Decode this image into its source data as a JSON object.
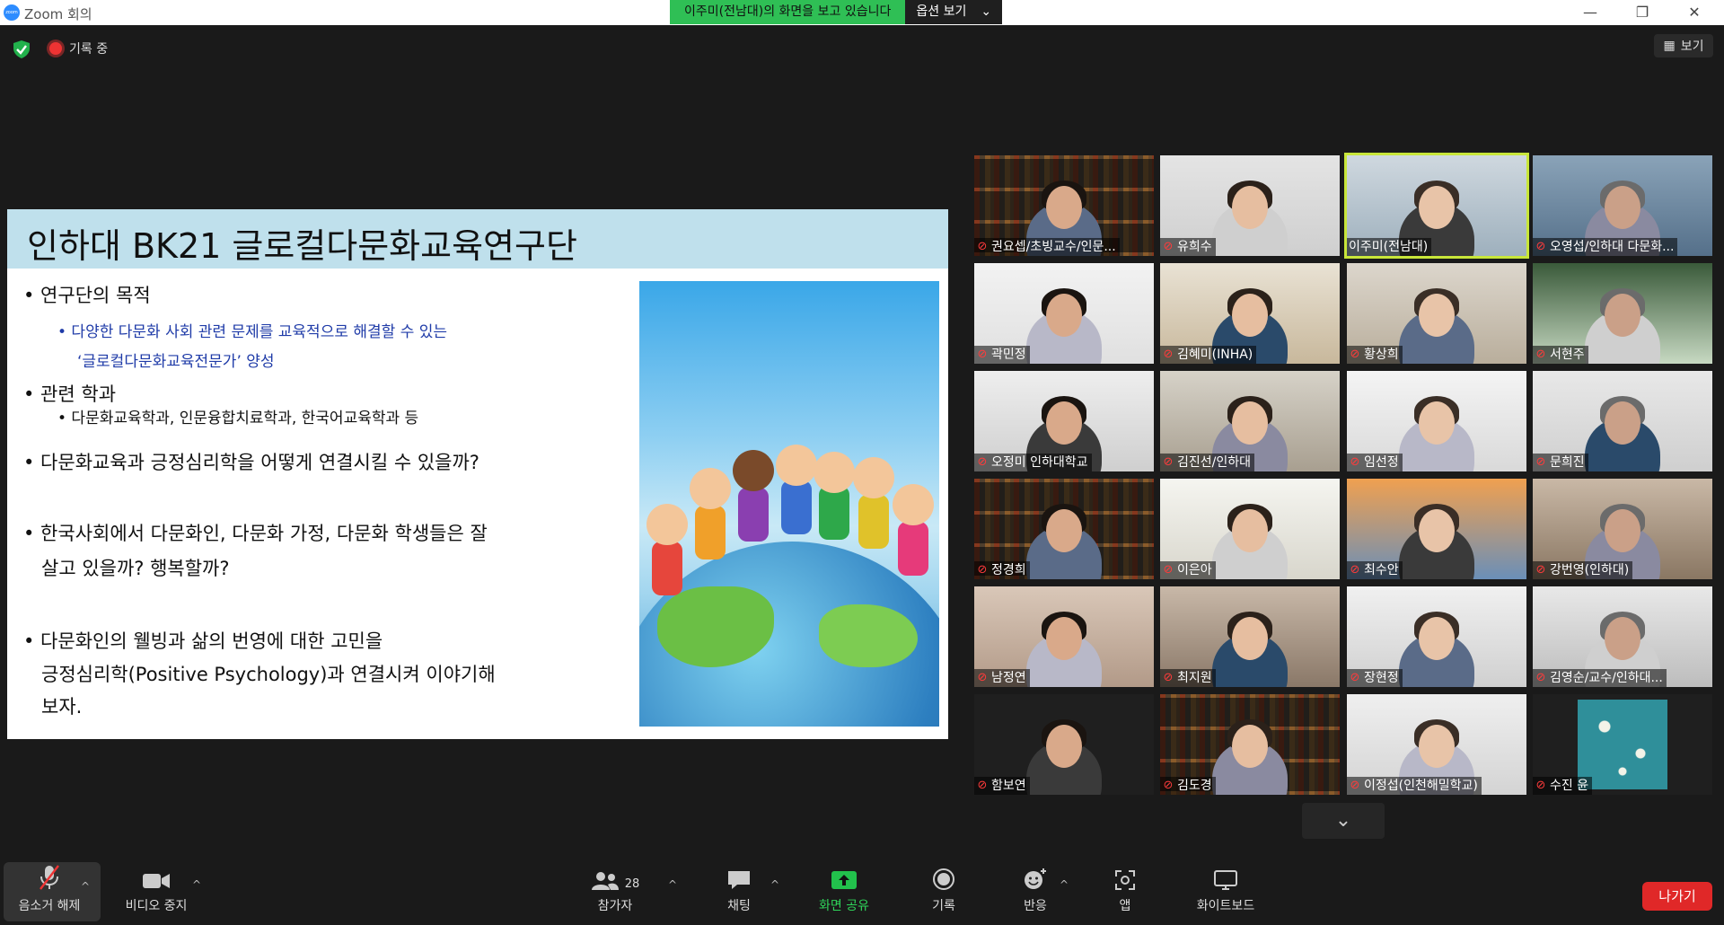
{
  "window": {
    "app_title": "Zoom 회의",
    "share_message": "이주미(전남대)의 화면을 보고 있습니다",
    "share_options_label": "옵션 보기"
  },
  "topbar": {
    "recording_label": "기록 중",
    "view_label": "보기"
  },
  "slide": {
    "title": "인하대 BK21 글로컬다문화교육연구단",
    "bullets": [
      "• 연구단의 목적",
      "• 다양한 다문화 사회 관련 문제를 교육적으로 해결할 수 있는",
      "‘글로컬다문화교육전문가’ 양성",
      "• 관련 학과",
      "• 다문화교육학과, 인문융합치료학과, 한국어교육학과 등",
      "• 다문화교육과 긍정심리학을 어떻게 연결시킬 수 있을까?",
      "• 한국사회에서 다문화인, 다문화 가정, 다문화 학생들은 잘",
      "살고 있을까? 행복할까?",
      "• 다문화인의 웰빙과 삶의 번영에 대한 고민을",
      "긍정심리학(Positive Psychology)과 연결시켜 이야기해",
      "보자."
    ]
  },
  "participants": [
    {
      "name": "권요셉/초빙교수/인문...",
      "muted": true
    },
    {
      "name": "유희수",
      "muted": true
    },
    {
      "name": "이주미(전남대)",
      "muted": false
    },
    {
      "name": "오영섭/인하대 다문화...",
      "muted": true
    },
    {
      "name": "곽민정",
      "muted": true
    },
    {
      "name": "김혜미(INHA)",
      "muted": true
    },
    {
      "name": "황상희",
      "muted": true
    },
    {
      "name": "서현주",
      "muted": true
    },
    {
      "name": "오정미 인하대학교",
      "muted": true
    },
    {
      "name": "김진선/인하대",
      "muted": true
    },
    {
      "name": "임선정",
      "muted": true
    },
    {
      "name": "문희진",
      "muted": true
    },
    {
      "name": "정경희",
      "muted": true
    },
    {
      "name": "이은아",
      "muted": true
    },
    {
      "name": "최수안",
      "muted": true
    },
    {
      "name": "강번영(인하대)",
      "muted": true
    },
    {
      "name": "남정연",
      "muted": true
    },
    {
      "name": "최지원",
      "muted": true
    },
    {
      "name": "장현정",
      "muted": true
    },
    {
      "name": "김영순/교수/인하대...",
      "muted": true
    },
    {
      "name": "함보연",
      "muted": true
    },
    {
      "name": "김도경",
      "muted": true
    },
    {
      "name": "이정섭(인천해밀학교)",
      "muted": true
    },
    {
      "name": "수진 윤",
      "muted": true
    }
  ],
  "toolbar": {
    "unmute_label": "음소거 해제",
    "video_label": "비디오 중지",
    "participants_label": "참가자",
    "participants_count": "28",
    "chat_label": "채팅",
    "share_label": "화면 공유",
    "record_label": "기록",
    "reactions_label": "반응",
    "apps_label": "앱",
    "whiteboard_label": "화이트보드",
    "leave_label": "나가기"
  },
  "colors": {
    "share_green": "#2fbf55",
    "active_speaker": "#c8e63a",
    "leave_red": "#e02828",
    "slide_header": "#bfe0ec"
  }
}
